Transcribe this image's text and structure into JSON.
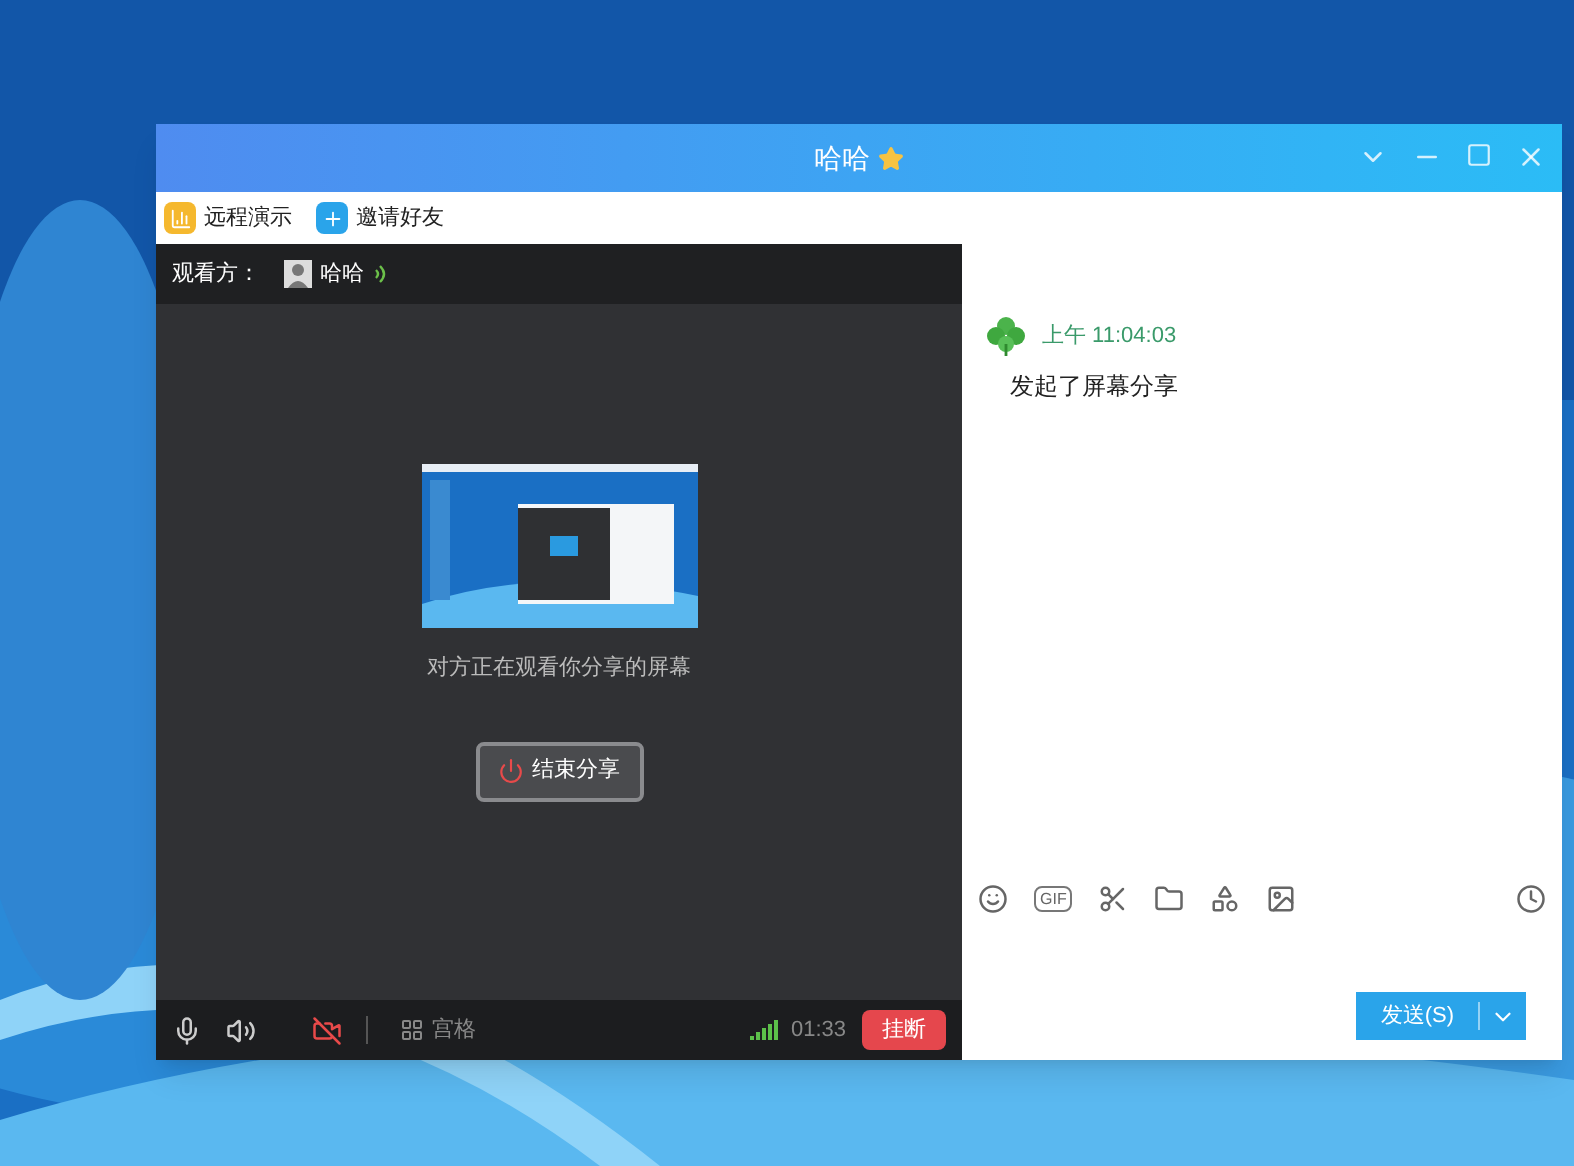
{
  "window": {
    "title": "哈哈"
  },
  "toolbar": [
    {
      "kind": "present",
      "label": "远程演示"
    },
    {
      "kind": "invite",
      "label": "邀请好友"
    }
  ],
  "viewers": {
    "label": "观看方：",
    "name": "哈哈"
  },
  "share": {
    "status": "对方正在观看你分享的屏幕",
    "stop_button": "结束分享"
  },
  "call_bar": {
    "camera_on": false,
    "grid_label": "宫格",
    "time": "01:33",
    "hangup": "挂断"
  },
  "messages": [
    {
      "time": "上午 11:04:03",
      "text": "发起了屏幕分享"
    }
  ],
  "composer": {
    "gif_label": "GIF",
    "send": "发送(S)"
  }
}
